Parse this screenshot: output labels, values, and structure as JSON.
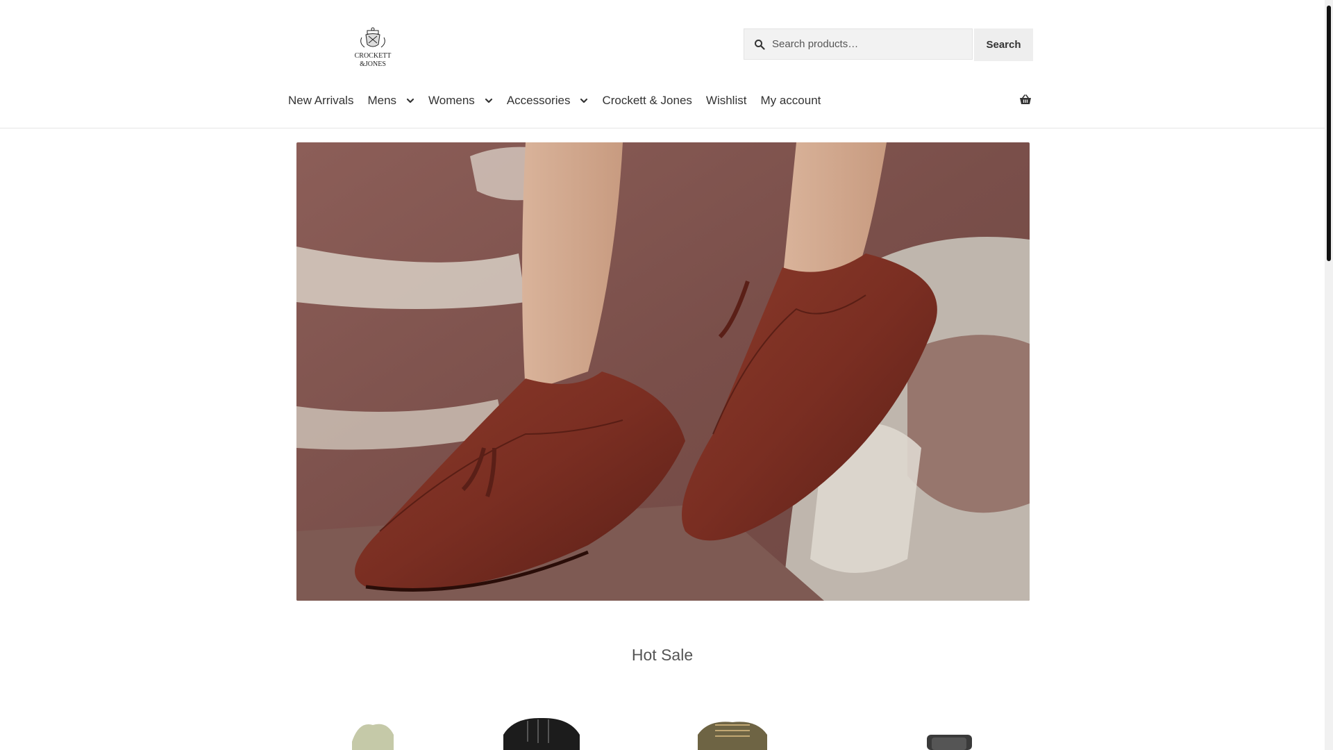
{
  "brand": {
    "logo_text_line1": "CROCKETT",
    "logo_text_line2": "&JONES"
  },
  "search": {
    "placeholder": "Search products…",
    "button_label": "Search",
    "icon": "search-icon"
  },
  "nav": {
    "items": [
      {
        "label": "New Arrivals",
        "has_dropdown": false
      },
      {
        "label": "Mens",
        "has_dropdown": true
      },
      {
        "label": "Womens",
        "has_dropdown": true
      },
      {
        "label": "Accessories",
        "has_dropdown": true
      },
      {
        "label": "Crockett & Jones",
        "has_dropdown": false
      },
      {
        "label": "Wishlist",
        "has_dropdown": false
      },
      {
        "label": "My account",
        "has_dropdown": false
      }
    ],
    "cart_icon": "basket-icon"
  },
  "hero": {
    "image": "tassel-loafer-hero-image"
  },
  "hot_sale": {
    "title": "Hot Sale",
    "products": [
      {
        "image": "green-boot-product-image"
      },
      {
        "image": "black-boot-product-image"
      },
      {
        "image": "olive-boot-product-image"
      },
      {
        "image": "dark-shoe-product-image"
      }
    ]
  },
  "colors": {
    "text": "#333333",
    "button_bg": "#eeeeee",
    "search_bg": "#f2f2f2"
  }
}
